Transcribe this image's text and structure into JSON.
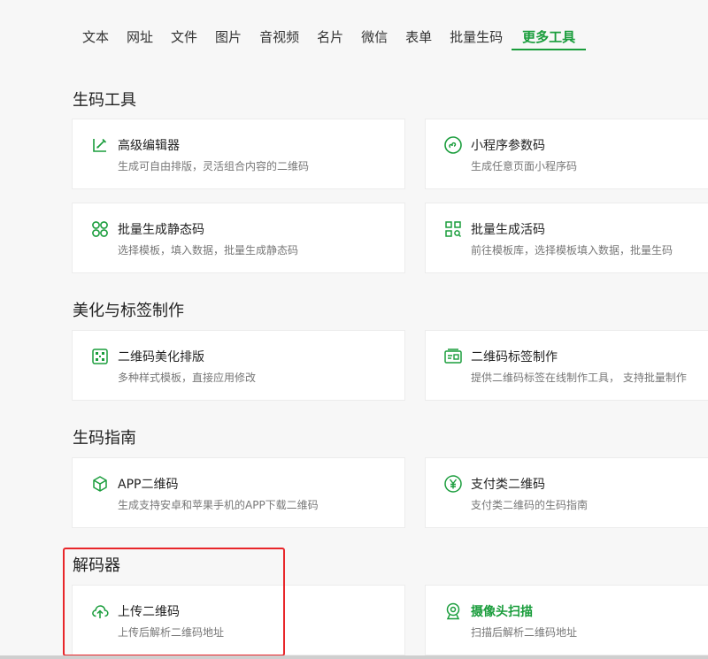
{
  "tabs": [
    {
      "label": "文本"
    },
    {
      "label": "网址"
    },
    {
      "label": "文件"
    },
    {
      "label": "图片"
    },
    {
      "label": "音视频"
    },
    {
      "label": "名片"
    },
    {
      "label": "微信"
    },
    {
      "label": "表单"
    },
    {
      "label": "批量生码"
    },
    {
      "label": "更多工具",
      "active": true
    }
  ],
  "sections": {
    "generate": {
      "title": "生码工具",
      "cards": [
        {
          "title": "高级编辑器",
          "desc": "生成可自由排版，灵活组合内容的二维码",
          "icon": "edit-icon"
        },
        {
          "title": "小程序参数码",
          "desc": "生成任意页面小程序码",
          "icon": "mini-program-icon"
        },
        {
          "title": "批量生成静态码",
          "desc": "选择模板，填入数据，批量生成静态码",
          "icon": "batch-static-icon"
        },
        {
          "title": "批量生成活码",
          "desc": "前往模板库，选择模板填入数据，批量生码",
          "icon": "batch-dynamic-icon"
        }
      ]
    },
    "beautify": {
      "title": "美化与标签制作",
      "cards": [
        {
          "title": "二维码美化排版",
          "desc": "多种样式模板，直接应用修改",
          "icon": "qr-beautify-icon"
        },
        {
          "title": "二维码标签制作",
          "desc": "提供二维码标签在线制作工具， 支持批量制作",
          "icon": "label-icon"
        }
      ]
    },
    "guide": {
      "title": "生码指南",
      "cards": [
        {
          "title": "APP二维码",
          "desc": "生成支持安卓和苹果手机的APP下载二维码",
          "icon": "box-icon"
        },
        {
          "title": "支付类二维码",
          "desc": "支付类二维码的生码指南",
          "icon": "yen-icon"
        }
      ]
    },
    "decoder": {
      "title": "解码器",
      "cards": [
        {
          "title": "上传二维码",
          "desc": "上传后解析二维码地址",
          "icon": "upload-cloud-icon"
        },
        {
          "title": "摄像头扫描",
          "desc": "扫描后解析二维码地址",
          "icon": "camera-icon"
        }
      ]
    }
  },
  "colors": {
    "accent": "#1a9d3c",
    "highlight": "#e8262a"
  }
}
